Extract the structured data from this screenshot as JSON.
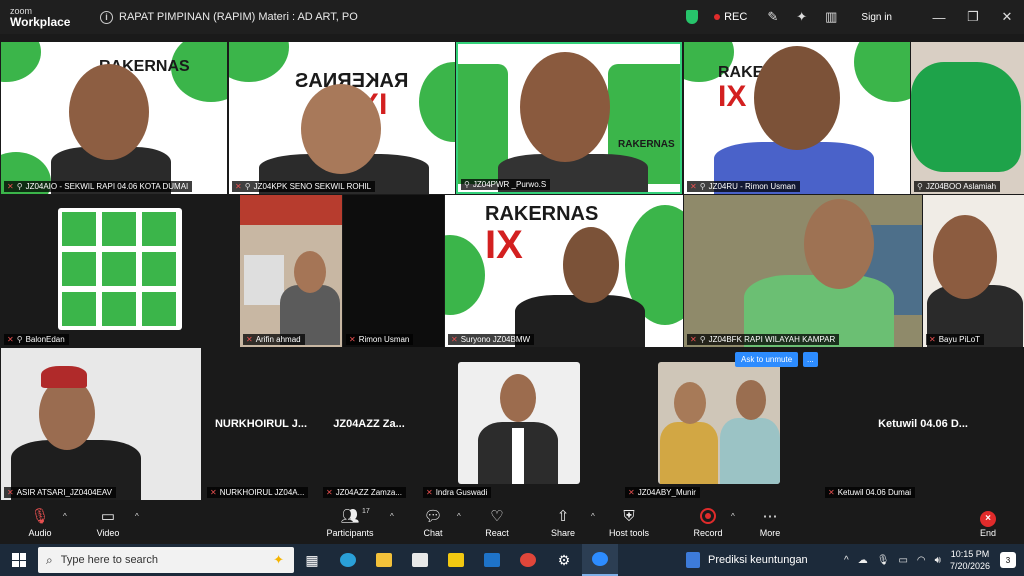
{
  "app": {
    "brand_top": "zoom",
    "brand_bottom": "Workplace",
    "meeting_title": "RAPAT PIMPINAN (RAPIM) Materi : AD ART, PO",
    "rec_label": "REC",
    "sign_in": "Sign in"
  },
  "backdrop": {
    "rakernas": "RAKERNAS",
    "ix": "IX",
    "rapi": "RAPI"
  },
  "participants": [
    {
      "label": "JZ04AIO - SEKWIL RAPI 04.06 KOTA DUMAI"
    },
    {
      "label": "JZ04KPK SENO SEKWIL ROHIL"
    },
    {
      "label": "JZ04PWR _Purwo.S"
    },
    {
      "label": "JZ04RU - Rimon Usman"
    },
    {
      "label": "JZ04BOO Aslamiah"
    },
    {
      "label": "BalonEdan"
    },
    {
      "label": "Arifin ahmad"
    },
    {
      "label": "Rimon Usman"
    },
    {
      "label": "Suryono JZ04BMW"
    },
    {
      "label": "JZ04BFK RAPI WILAYAH KAMPAR"
    },
    {
      "label": "Bayu PiLoT"
    },
    {
      "label": "ASIR ATSARI_JZ0404EAV"
    },
    {
      "label": "NURKHOIRUL JZ04A...",
      "big": "NURKHOIRUL J..."
    },
    {
      "label": "JZ04AZZ Zamza...",
      "big": "JZ04AZZ Za..."
    },
    {
      "label": "Indra Guswadi"
    },
    {
      "label": "JZ04ABY_Munir"
    },
    {
      "label": "Ketuwil 04.06 Dumai",
      "big": "Ketuwil 04.06 D..."
    }
  ],
  "unmute_prompt": "Ask to unmute",
  "unmute_more": "...",
  "toolbar": {
    "audio": "Audio",
    "video": "Video",
    "participants": "Participants",
    "participants_count": "17",
    "chat": "Chat",
    "react": "React",
    "share": "Share",
    "host_tools": "Host tools",
    "record": "Record",
    "more": "More",
    "end": "End"
  },
  "taskbar": {
    "search_placeholder": "Type here to search",
    "weather_text": "Prediksi keuntungan",
    "time": "10:15 PM",
    "date": "7/20/2026",
    "notifications": "3"
  },
  "colors": {
    "accent_blue": "#2d8cff",
    "rec_red": "#e02b2b",
    "secure_green": "#27c46b",
    "backdrop_green": "#3bb54a"
  }
}
